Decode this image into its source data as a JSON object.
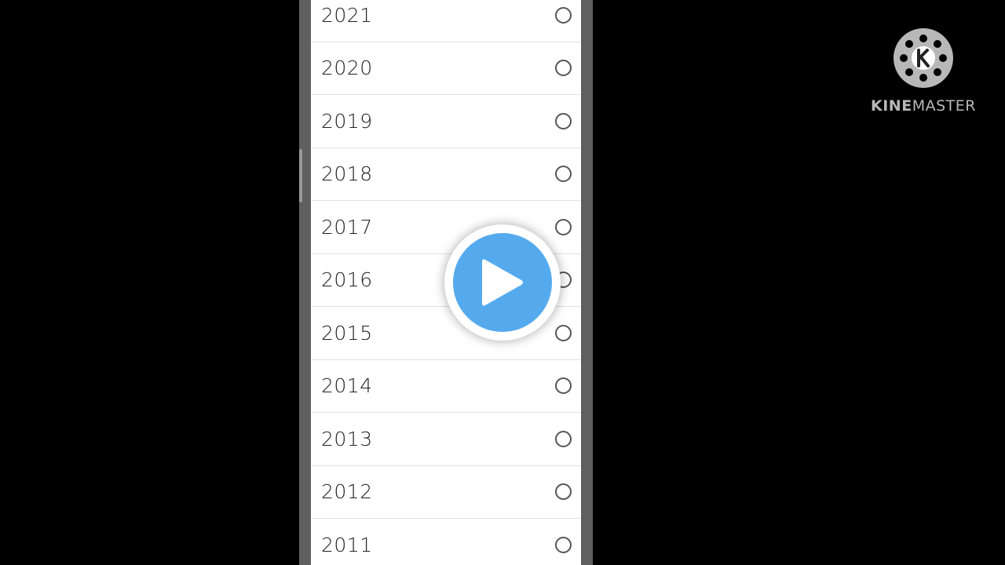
{
  "year_picker": {
    "years": [
      {
        "label": "2021",
        "selected": false
      },
      {
        "label": "2020",
        "selected": false
      },
      {
        "label": "2019",
        "selected": false
      },
      {
        "label": "2018",
        "selected": false
      },
      {
        "label": "2017",
        "selected": false
      },
      {
        "label": "2016",
        "selected": false
      },
      {
        "label": "2015",
        "selected": false
      },
      {
        "label": "2014",
        "selected": false
      },
      {
        "label": "2013",
        "selected": false
      },
      {
        "label": "2012",
        "selected": false
      },
      {
        "label": "2011",
        "selected": false
      }
    ]
  },
  "overlay": {
    "icon": "play-icon",
    "color": "#55aaee"
  },
  "watermark": {
    "icon": "kinemaster-logo-icon",
    "text_bold": "KINE",
    "text_regular": "MASTER",
    "color": "#b8b8b8"
  },
  "colors": {
    "background": "#000000",
    "frame": "#5f5f5f",
    "dialog": "#ffffff"
  }
}
